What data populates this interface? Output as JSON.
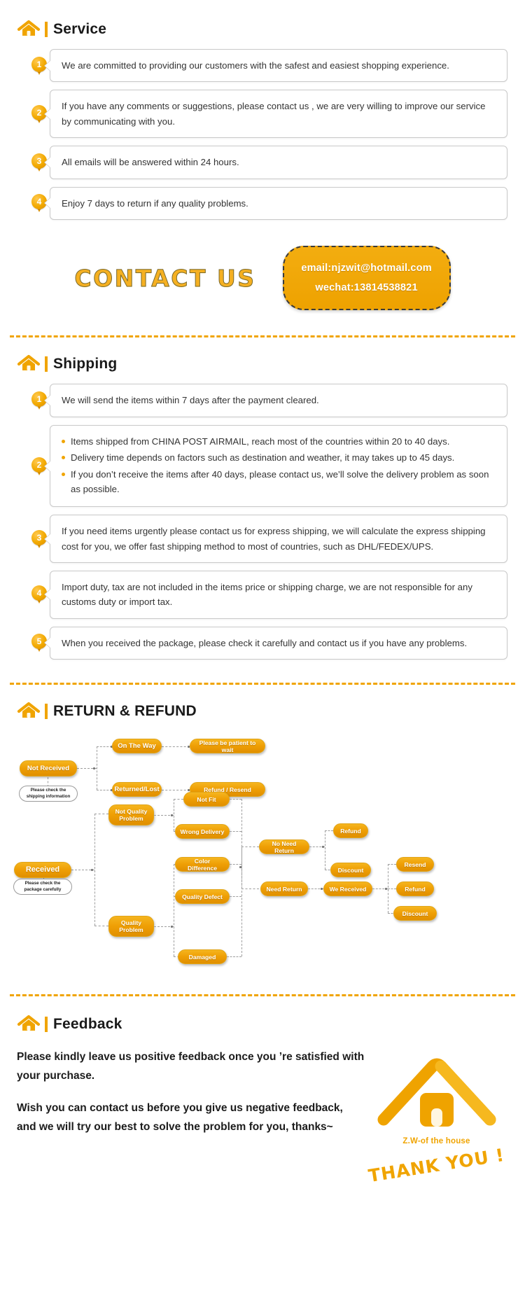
{
  "brand": {
    "logo_icon": "house-icon",
    "accent": "#f0a400",
    "node_color": "#ef9f05"
  },
  "service": {
    "heading": "Service",
    "items": [
      {
        "num": "1",
        "text": "We are committed to providing our customers with the safest and easiest shopping experience."
      },
      {
        "num": "2",
        "text": "If you have any comments or suggestions, please contact us , we are very willing to improve our service by communicating with you."
      },
      {
        "num": "3",
        "text": "All emails will be answered within 24 hours."
      },
      {
        "num": "4",
        "text": "Enjoy 7 days to return if any quality problems."
      }
    ],
    "contact": {
      "title": "CONTACT US",
      "email": "email:njzwit@hotmail.com",
      "wechat": "wechat:13814538821"
    }
  },
  "shipping": {
    "heading": "Shipping",
    "items": [
      {
        "num": "1",
        "text": "We will send the items within 7 days after the payment cleared."
      },
      {
        "num": "2",
        "bullets": [
          "Items shipped from CHINA POST AIRMAIL, reach most of the countries within 20 to 40 days.",
          "Delivery time depends on factors such as destination and weather, it may takes up to 45 days.",
          "If you don’t receive the items after 40 days, please contact us, we’ll solve the delivery problem as soon as possible."
        ]
      },
      {
        "num": "3",
        "text": "If you need items urgently please contact us for express shipping, we will calculate the express shipping cost for you, we offer fast shipping method to most of countries, such as DHL/FEDEX/UPS."
      },
      {
        "num": "4",
        "text": "Import duty, tax are not included in the items price or shipping charge, we are not responsible for any customs duty or import tax."
      },
      {
        "num": "5",
        "text": "When you received the package, please check it carefully and contact us if you have any problems."
      }
    ]
  },
  "returns": {
    "heading": "RETURN & REFUND",
    "flow": {
      "not_received": "Not Received",
      "not_received_note": "Please check the shipping information",
      "on_the_way": "On The Way",
      "be_patient": "Please be patient to wait",
      "returned_lost": "Returned/Lost",
      "refund_resend": "Refund / Resend",
      "received": "Received",
      "received_note": "Please check the package carefully",
      "not_quality_problem": "Not Quality Problem",
      "quality_problem": "Quality Problem",
      "not_fit": "Not Fit",
      "wrong_delivery": "Wrong Delivery",
      "color_difference": "Color Difference",
      "quality_defect": "Quality Defect",
      "damaged": "Damaged",
      "no_need_return": "No Need Return",
      "need_return": "Need Return",
      "refund_a": "Refund",
      "discount_a": "Discount",
      "we_received": "We Received",
      "resend": "Resend",
      "refund_b": "Refund",
      "discount_b": "Discount"
    }
  },
  "feedback": {
    "heading": "Feedback",
    "paragraph1": "Please kindly leave us positive feedback once you ’re satisfied with your purchase.",
    "paragraph2": "Wish you can contact us before you give us negative feedback, and we will try our best to solve the problem for you, thanks~",
    "brand_name": "Z.W-of the house",
    "thank_you": "THANK YOU !"
  }
}
